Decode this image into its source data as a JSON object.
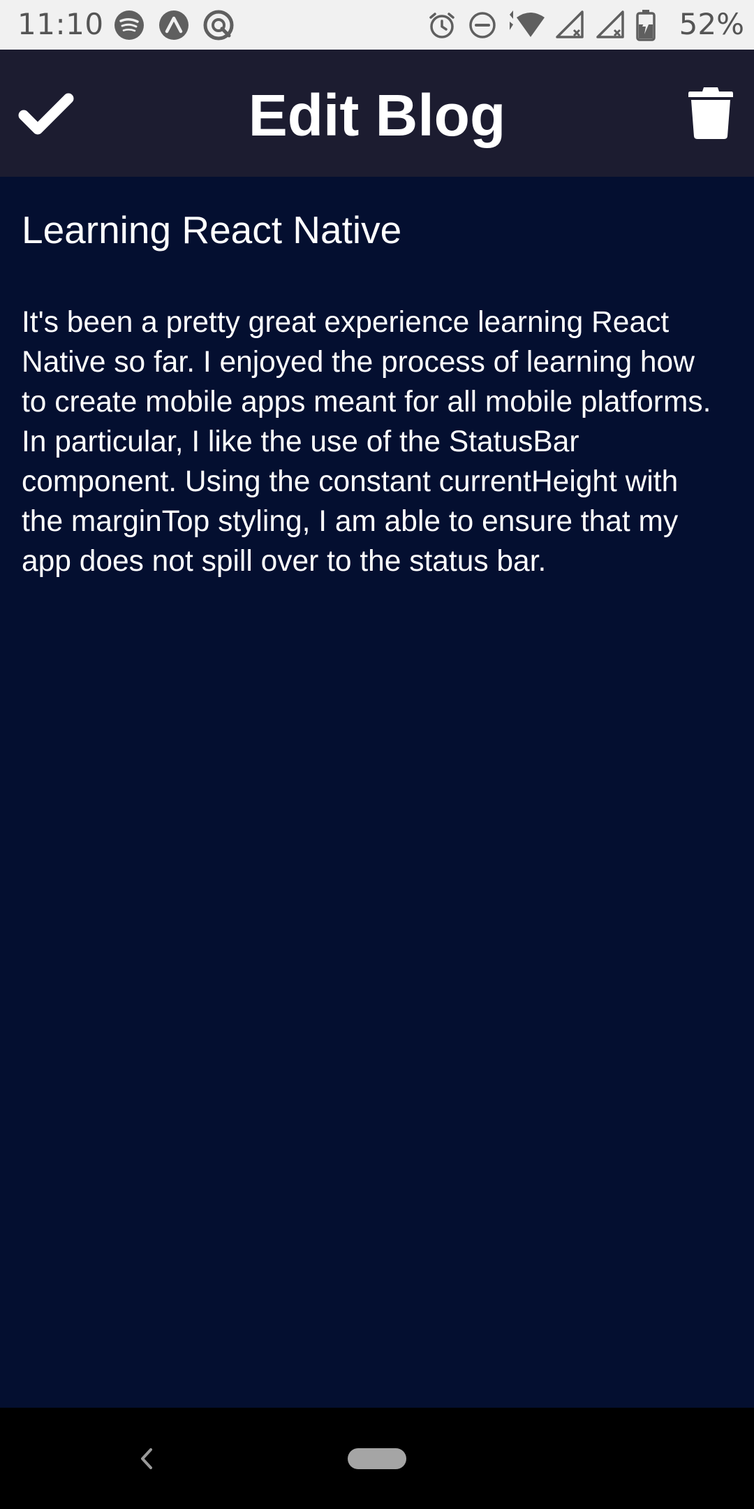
{
  "status_bar": {
    "time": "11:10",
    "battery_percent": "52%",
    "left_icons": [
      "spotify-icon",
      "expo-icon",
      "app-notification-icon"
    ],
    "right_icons": [
      "alarm-icon",
      "do-not-disturb-icon",
      "wifi-icon",
      "signal-icon",
      "signal-icon",
      "battery-charging-icon"
    ]
  },
  "header": {
    "title": "Edit Blog",
    "save_icon": "checkmark-icon",
    "delete_icon": "trash-icon",
    "background_color": "#1c1c30"
  },
  "editor": {
    "title_value": "Learning React Native",
    "body_value": "It's been a pretty great experience learning React Native so far. I enjoyed the process of learning how to create mobile apps meant for all mobile platforms. In particular, I like the use of the StatusBar component. Using the constant currentHeight with the marginTop styling, I am able to ensure that my app does not spill over to the status bar.",
    "background_color": "#040f30",
    "text_color": "#ffffff"
  },
  "nav_bar": {
    "back_icon": "chevron-left-icon",
    "home_icon": "home-pill-icon"
  }
}
